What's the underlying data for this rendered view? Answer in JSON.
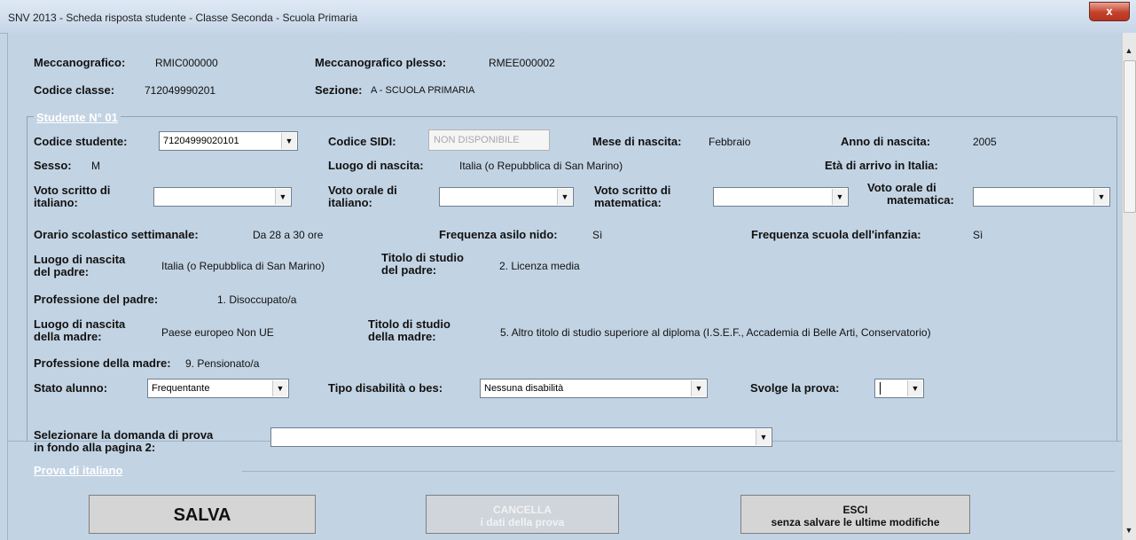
{
  "window": {
    "title": "SNV 2013 - Scheda risposta studente - Classe Seconda - Scuola Primaria",
    "close_label": "x"
  },
  "header": {
    "meccanografico_label": "Meccanografico:",
    "meccanografico_value": "RMIC000000",
    "plesso_label": "Meccanografico plesso:",
    "plesso_value": "RMEE000002",
    "classe_label": "Codice classe:",
    "classe_value": "712049990201",
    "sezione_label": "Sezione:",
    "sezione_value": "A  - SCUOLA PRIMARIA"
  },
  "student": {
    "legend": "Studente N° 01",
    "codice_studente_label": "Codice studente:",
    "codice_studente_value": "71204999020101",
    "codice_sidi_label": "Codice SIDI:",
    "codice_sidi_placeholder": "NON DISPONIBILE",
    "mese_label": "Mese di nascita:",
    "mese_value": "Febbraio",
    "anno_label": "Anno di nascita:",
    "anno_value": "2005",
    "sesso_label": "Sesso:",
    "sesso_value": "M",
    "luogo_label": "Luogo di nascita:",
    "luogo_value": "Italia (o Repubblica di San Marino)",
    "eta_label": "Età di arrivo in Italia:",
    "voto_scritto_ita_label_1": "Voto scritto di",
    "voto_scritto_ita_label_2": "italiano:",
    "voto_orale_ita_label_1": "Voto orale di",
    "voto_orale_ita_label_2": "italiano:",
    "voto_scritto_mat_label_1": "Voto scritto di",
    "voto_scritto_mat_label_2": "matematica:",
    "voto_orale_mat_label_1": "Voto orale di",
    "voto_orale_mat_label_2": "matematica:",
    "orario_label": "Orario scolastico settimanale:",
    "orario_value": "Da 28 a 30 ore",
    "asilo_label": "Frequenza asilo nido:",
    "asilo_value": "Sì",
    "infanzia_label": "Frequenza scuola dell'infanzia:",
    "infanzia_value": "Sì",
    "luogo_padre_label_1": "Luogo di nascita",
    "luogo_padre_label_2": "del padre:",
    "luogo_padre_value": "Italia (o Repubblica di San Marino)",
    "titolo_padre_label_1": "Titolo di studio",
    "titolo_padre_label_2": "del padre:",
    "titolo_padre_value": "2. Licenza media",
    "professione_padre_label": "Professione del padre:",
    "professione_padre_value": "1. Disoccupato/a",
    "luogo_madre_label_1": "Luogo di nascita",
    "luogo_madre_label_2": "della madre:",
    "luogo_madre_value": "Paese europeo Non UE",
    "titolo_madre_label_1": "Titolo di studio",
    "titolo_madre_label_2": "della madre:",
    "titolo_madre_value": "5. Altro titolo di studio superiore al diploma (I.S.E.F., Accademia di Belle Arti, Conservatorio)",
    "professione_madre_label": "Professione della madre:",
    "professione_madre_value": "9. Pensionato/a",
    "stato_label": "Stato alunno:",
    "stato_value": "Frequentante",
    "disabilita_label": "Tipo disabilità o bes:",
    "disabilita_value": "Nessuna disabilità",
    "svolge_label": "Svolge la prova:",
    "svolge_value": ""
  },
  "question": {
    "select_label_1": "Selezionare la domanda di prova",
    "select_label_2": "in fondo alla pagina 2:",
    "section_title": "Prova di italiano"
  },
  "buttons": {
    "salva": "SALVA",
    "cancella_1": "CANCELLA",
    "cancella_2": "i dati della prova",
    "esci_1": "ESCI",
    "esci_2": "senza salvare le ultime modifiche"
  },
  "icons": {
    "dropdown": "chevron-down-icon",
    "close": "close-icon"
  }
}
